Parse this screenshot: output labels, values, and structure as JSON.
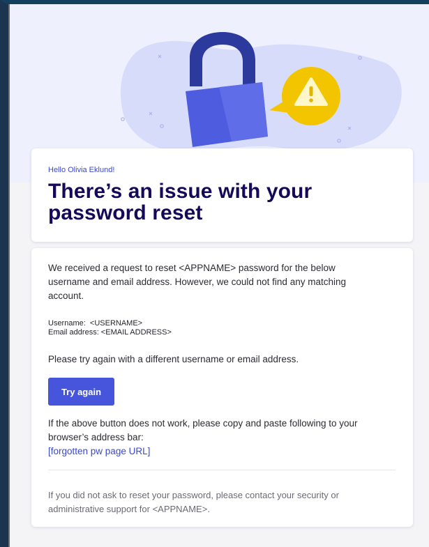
{
  "header": {
    "greeting": "Hello Olivia Eklund!",
    "title": "There’s an issue with your password reset"
  },
  "body": {
    "intro": "We received a request to reset <APPNAME> password for the below username and email address. However, we could not find any matching account.",
    "username_line": "Username:  <USERNAME>",
    "email_line": "Email address: <EMAIL ADDRESS>",
    "retry_text": "Please try again with a different username or email address.",
    "button_label": "Try again",
    "fallback_text": "If the above button does not work, please copy and paste following to your browser’s address bar:",
    "fallback_link": "[forgotten pw page URL]",
    "footer_note": "If you did not ask to reset your password, please contact your security or administrative support for <APPNAME>."
  },
  "colors": {
    "accent": "#4655dc",
    "title": "#150a59",
    "hero_bg": "#eef0fd",
    "warning": "#f2c500"
  },
  "icons": {
    "hero": "padlock-icon",
    "badge": "warning-icon"
  }
}
